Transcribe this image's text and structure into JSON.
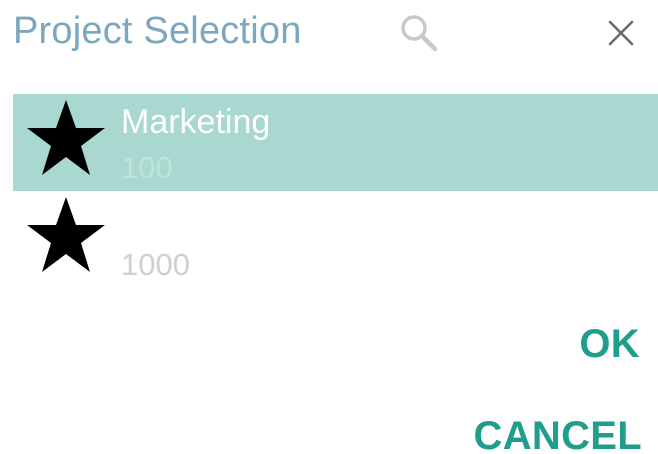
{
  "dialog": {
    "title": "Project Selection",
    "search_icon": "search-icon",
    "close_icon": "close-icon",
    "accent_color": "#1f9e8c",
    "title_color": "#7ba7bf",
    "selected_row_color": "#a8d8cf"
  },
  "projects": [
    {
      "name": "Marketing",
      "count": "100",
      "icon": "star-icon",
      "selected": true
    },
    {
      "name": "",
      "count": "1000",
      "icon": "star-icon",
      "selected": false
    }
  ],
  "actions": {
    "ok_label": "OK",
    "cancel_label": "CANCEL"
  }
}
